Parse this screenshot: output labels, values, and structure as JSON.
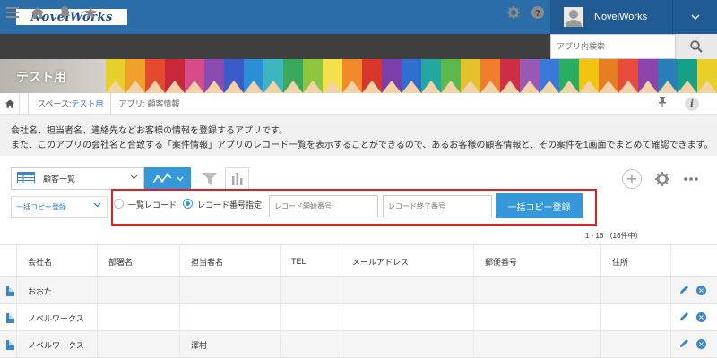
{
  "app": {
    "logo_text": "NovelWorks"
  },
  "header": {
    "user_name": "NovelWorks",
    "search_placeholder": "アプリ内検索"
  },
  "banner": {
    "space_title": "テスト用"
  },
  "breadcrumb": {
    "space_label": "スペース: ",
    "space_link": "テスト用",
    "app_label": "アプリ: 顧客情報"
  },
  "description": {
    "line1": "会社名、担当者名、連絡先などお客様の情報を登録するアプリです。",
    "line2": "また、このアプリの会社名と合致する「案件情報」アプリのレコード一覧を表示することができるので、あるお客様の顧客情報と、その案件を1画面でまとめて確認できます。"
  },
  "toolbar": {
    "view_name": "顧客一覧",
    "bulk_select": "一括コピー登録"
  },
  "bulk_copy": {
    "radio_all_label": "一覧レコード",
    "radio_range_label": "レコード番号指定",
    "selected": "レコード番号指定",
    "start_placeholder": "レコード開始番号",
    "end_placeholder": "レコード終了番号",
    "submit_label": "一括コピー登録"
  },
  "pagination": {
    "text": "1 - 16 （16件中）"
  },
  "table": {
    "columns": [
      "会社名",
      "部署名",
      "担当者名",
      "TEL",
      "メールアドレス",
      "郵便番号",
      "住所"
    ],
    "rows": [
      [
        "おおた",
        "",
        "",
        "",
        "",
        "",
        ""
      ],
      [
        "ノベルワークス",
        "",
        "",
        "",
        "",
        "",
        ""
      ],
      [
        "ノベルワークス",
        "",
        "澤村",
        "",
        "",
        "",
        ""
      ]
    ]
  },
  "colors": {
    "header_blue": "#2c6eaa",
    "accent_blue": "#3498db",
    "highlight_red": "#e02020",
    "nav_dark": "#3f3f3f"
  }
}
